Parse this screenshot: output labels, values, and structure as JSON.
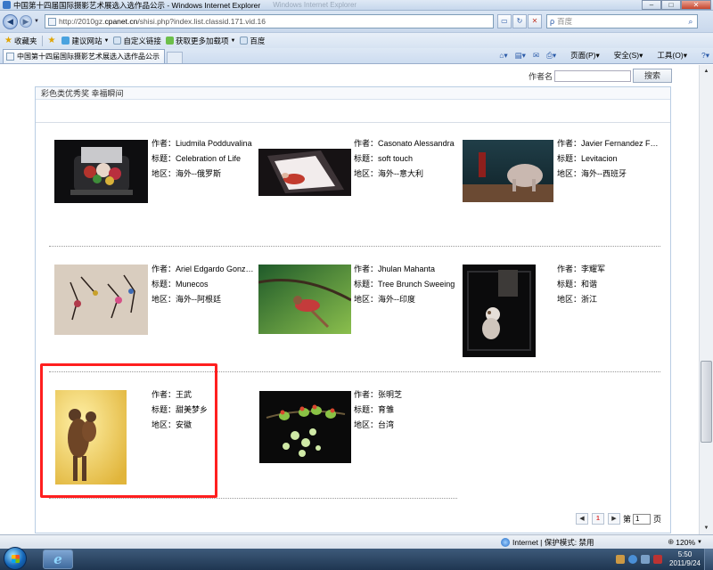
{
  "window": {
    "title": "中国第十四届国际摄影艺术展选入选作品公示 - Windows Internet Explorer",
    "ghost_title": "Windows Internet Explorer",
    "buttons": {
      "min": "–",
      "max": "□",
      "close": "✕"
    }
  },
  "address": {
    "url_prefix": "http://2010gz.",
    "url_domain": "cpanet.cn",
    "url_rest": "/shisi.php?index.list.classid.171.vid.16",
    "search_placeholder": "百度"
  },
  "favorites": {
    "label": "收藏夹",
    "items": [
      "建议网站",
      "自定义链接",
      "获取更多加载项",
      "百度"
    ]
  },
  "tab": {
    "title": "中国第十四届国际摄影艺术展选入选作品公示"
  },
  "commands": {
    "page": "页面(P)",
    "safety": "安全(S)",
    "tools": "工具(O)",
    "help": "?"
  },
  "content": {
    "author_search_label": "作者名",
    "author_search_value": "",
    "search_button": "搜索",
    "section_title": "彩色类优秀奖 幸福瞬间",
    "field_labels": {
      "author": "作者：",
      "title": "标题：",
      "region": "地区："
    },
    "works": [
      {
        "author": "Liudmila Podduvalina",
        "title": "Celebration of Life",
        "region": "海外--俄罗斯"
      },
      {
        "author": "Casonato Alessandra",
        "title": "soft touch",
        "region": "海外--意大利"
      },
      {
        "author": "Javier Fernandez F…",
        "title": "Levitacion",
        "region": "海外--西班牙"
      },
      {
        "author": "Ariel Edgardo Gonz…",
        "title": "Munecos",
        "region": "海外--阿根廷"
      },
      {
        "author": "Jhulan Mahanta",
        "title": "Tree Brunch Sweeing",
        "region": "海外--印度"
      },
      {
        "author": "李耀军",
        "title": "和谐",
        "region": "浙江"
      },
      {
        "author": "王武",
        "title": "甜美梦乡",
        "region": "安徽"
      },
      {
        "author": "张明芝",
        "title": "育雏",
        "region": "台湾"
      }
    ],
    "pager": {
      "current": "1",
      "prefix": "第",
      "select": "1",
      "suffix": "页"
    }
  },
  "status": {
    "zone": "Internet | 保护模式: 禁用",
    "zoom": "120%"
  },
  "taskbar": {
    "time": "5:50",
    "date": "2011/9/24"
  }
}
